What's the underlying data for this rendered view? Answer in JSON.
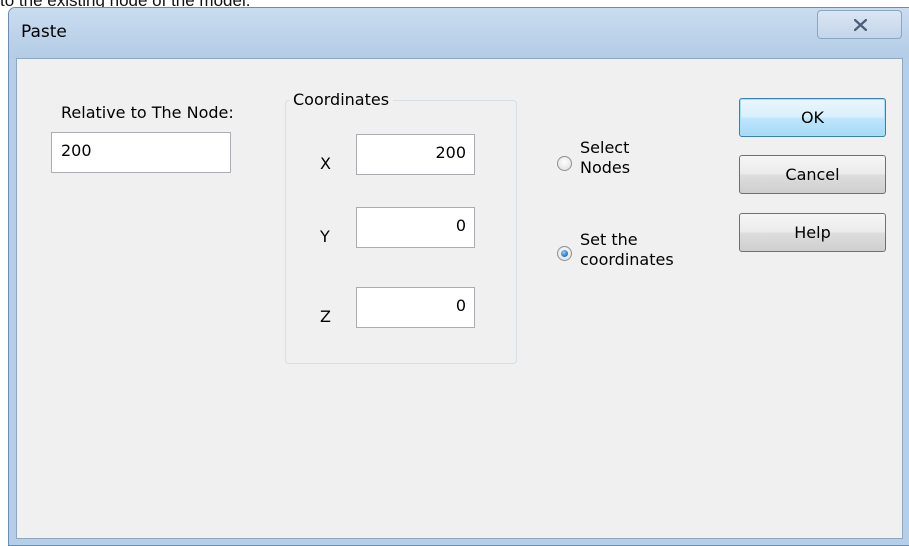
{
  "background_text": "to the existing node of the model.",
  "dialog": {
    "title": "Paste"
  },
  "relative": {
    "label": "Relative to The Node:",
    "value": "200"
  },
  "coordinates": {
    "legend": "Coordinates",
    "x_label": "X",
    "x_value": "200",
    "y_label": "Y",
    "y_value": "0",
    "z_label": "Z",
    "z_value": "0"
  },
  "options": [
    {
      "line1": "Select",
      "line2": "Nodes",
      "selected": false
    },
    {
      "line1": "Set the",
      "line2": "coordinates",
      "selected": true
    }
  ],
  "buttons": {
    "ok": "OK",
    "cancel": "Cancel",
    "help": "Help"
  }
}
